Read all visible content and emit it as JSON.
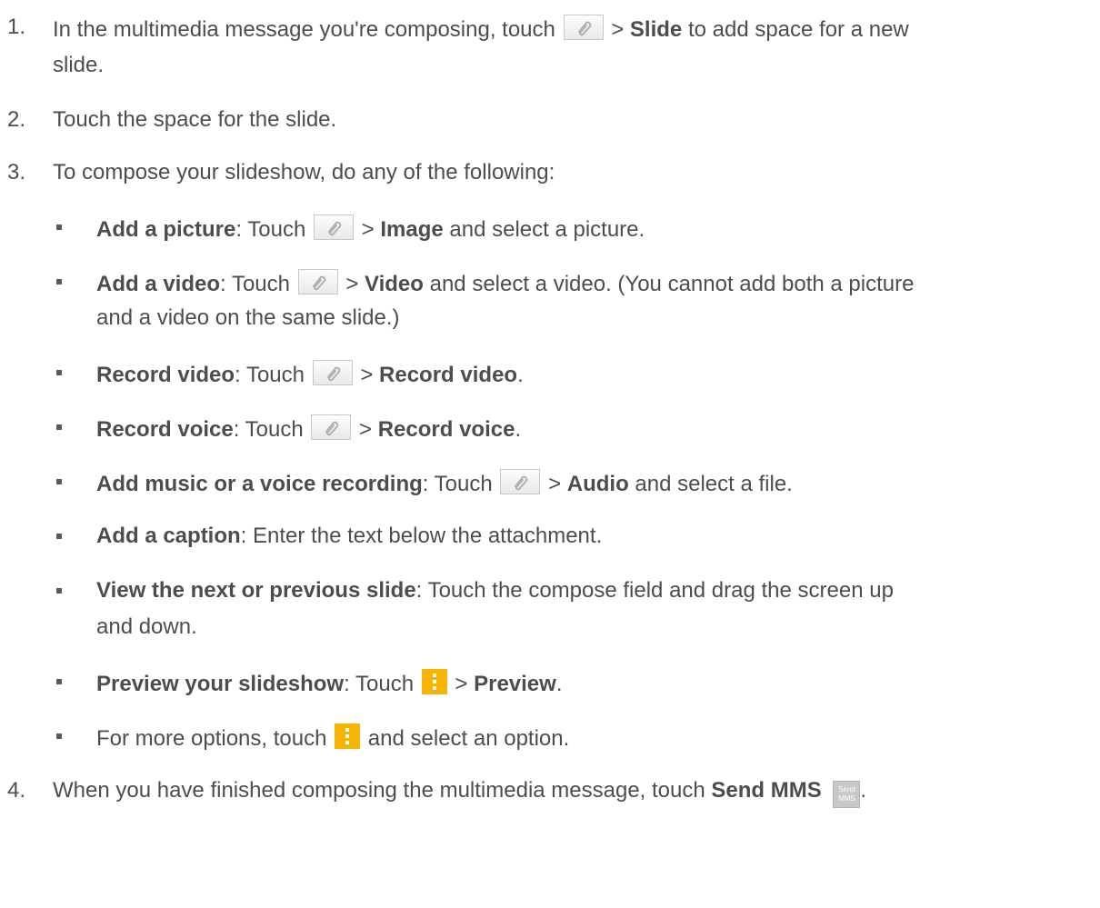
{
  "steps": [
    {
      "num": "1.",
      "line1_pre": "In the multimedia message you're composing, touch",
      "sep": ">",
      "line1_bold": "Slide",
      "line1_post": "to add space for a new",
      "line2": "slide."
    },
    {
      "num": "2.",
      "text": "Touch the space for the slide."
    },
    {
      "num": "3.",
      "text": "To compose your slideshow, do any of the following:"
    },
    {
      "num": "4.",
      "pre": "When you have finished composing the multimedia message, touch",
      "bold": "Send MMS",
      "icon_line1": "Send",
      "icon_line2": "MMS",
      "post": "."
    }
  ],
  "bullets": [
    {
      "bold": "Add a picture",
      "colon": ":",
      "pre": "Touch",
      "sep": ">",
      "target": "Image",
      "post": "and select a picture."
    },
    {
      "bold": "Add a video",
      "colon": ":",
      "pre": "Touch",
      "sep": ">",
      "target": "Video",
      "post": "and select a video. (You cannot add both a picture",
      "line2": "and a video on the same slide.)"
    },
    {
      "bold": "Record video",
      "colon": ":",
      "pre": "Touch",
      "sep": ">",
      "target": "Record video",
      "post": "."
    },
    {
      "bold": "Record voice",
      "colon": ":",
      "pre": "Touch",
      "sep": ">",
      "target": "Record voice",
      "post": "."
    },
    {
      "bold": "Add music or a voice recording",
      "colon": ":",
      "pre": "Touch",
      "sep": ">",
      "target": "Audio",
      "post": "and select a file."
    },
    {
      "bold": "Add a caption",
      "colon": ":",
      "post": "Enter the text below the attachment."
    },
    {
      "bold": "View the next or previous slide",
      "colon": ":",
      "post": "Touch the compose field and drag the screen up",
      "line2": "and down."
    },
    {
      "bold": "Preview your slideshow",
      "colon": ":",
      "pre": "Touch",
      "sep": ">",
      "target": "Preview",
      "post": "."
    },
    {
      "pre": "For more options, touch",
      "post": "and select an option."
    }
  ],
  "icons": {
    "attach": "paperclip-icon",
    "menu": "overflow-menu-icon",
    "send": "send-mms-icon",
    "menu_color": "#f5b400"
  }
}
